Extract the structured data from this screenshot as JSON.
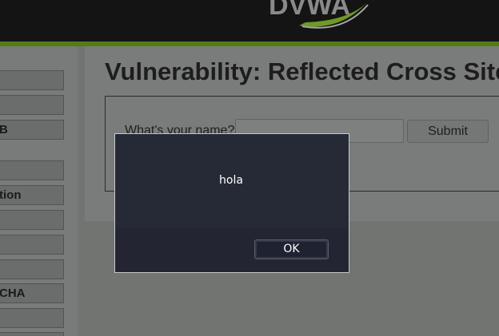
{
  "header": {
    "logo_text": "DVWA",
    "logo_icon": "dvwa-logo-swoosh",
    "stripe_color": "#557b17"
  },
  "sidebar": {
    "items": [
      {
        "label": ""
      },
      {
        "label": ""
      },
      {
        "label": "B"
      },
      {
        "label": ""
      },
      {
        "label": "tion"
      },
      {
        "label": ""
      },
      {
        "label": ""
      },
      {
        "label": ""
      },
      {
        "label": "CHA"
      },
      {
        "label": ""
      },
      {
        "label": ""
      }
    ]
  },
  "main": {
    "title": "Vulnerability: Reflected Cross Site",
    "form": {
      "label": "What's your name?",
      "input_value": "",
      "submit_label": "Submit"
    }
  },
  "dialog": {
    "message": "hola",
    "ok_label": "OK"
  }
}
